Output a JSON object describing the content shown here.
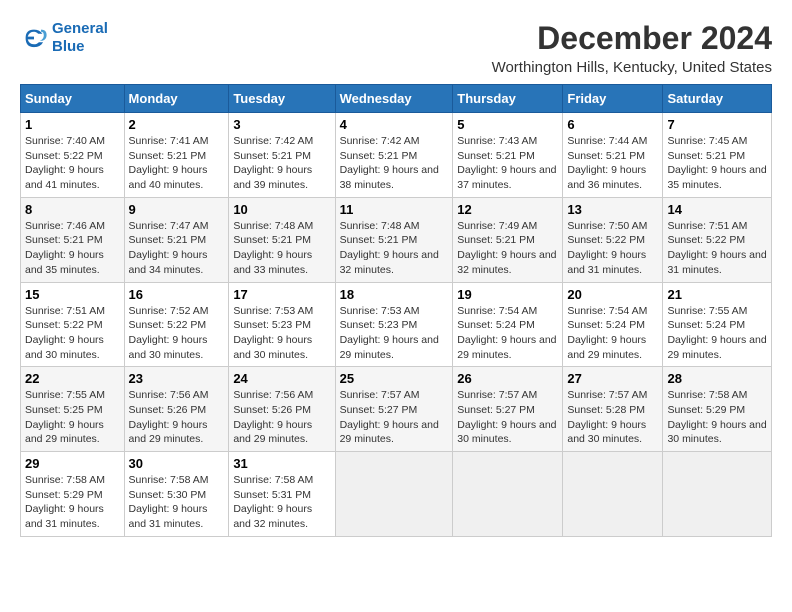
{
  "logo": {
    "line1": "General",
    "line2": "Blue"
  },
  "title": "December 2024",
  "subtitle": "Worthington Hills, Kentucky, United States",
  "headers": [
    "Sunday",
    "Monday",
    "Tuesday",
    "Wednesday",
    "Thursday",
    "Friday",
    "Saturday"
  ],
  "weeks": [
    [
      {
        "day": "1",
        "sunrise": "Sunrise: 7:40 AM",
        "sunset": "Sunset: 5:22 PM",
        "daylight": "Daylight: 9 hours and 41 minutes."
      },
      {
        "day": "2",
        "sunrise": "Sunrise: 7:41 AM",
        "sunset": "Sunset: 5:21 PM",
        "daylight": "Daylight: 9 hours and 40 minutes."
      },
      {
        "day": "3",
        "sunrise": "Sunrise: 7:42 AM",
        "sunset": "Sunset: 5:21 PM",
        "daylight": "Daylight: 9 hours and 39 minutes."
      },
      {
        "day": "4",
        "sunrise": "Sunrise: 7:42 AM",
        "sunset": "Sunset: 5:21 PM",
        "daylight": "Daylight: 9 hours and 38 minutes."
      },
      {
        "day": "5",
        "sunrise": "Sunrise: 7:43 AM",
        "sunset": "Sunset: 5:21 PM",
        "daylight": "Daylight: 9 hours and 37 minutes."
      },
      {
        "day": "6",
        "sunrise": "Sunrise: 7:44 AM",
        "sunset": "Sunset: 5:21 PM",
        "daylight": "Daylight: 9 hours and 36 minutes."
      },
      {
        "day": "7",
        "sunrise": "Sunrise: 7:45 AM",
        "sunset": "Sunset: 5:21 PM",
        "daylight": "Daylight: 9 hours and 35 minutes."
      }
    ],
    [
      {
        "day": "8",
        "sunrise": "Sunrise: 7:46 AM",
        "sunset": "Sunset: 5:21 PM",
        "daylight": "Daylight: 9 hours and 35 minutes."
      },
      {
        "day": "9",
        "sunrise": "Sunrise: 7:47 AM",
        "sunset": "Sunset: 5:21 PM",
        "daylight": "Daylight: 9 hours and 34 minutes."
      },
      {
        "day": "10",
        "sunrise": "Sunrise: 7:48 AM",
        "sunset": "Sunset: 5:21 PM",
        "daylight": "Daylight: 9 hours and 33 minutes."
      },
      {
        "day": "11",
        "sunrise": "Sunrise: 7:48 AM",
        "sunset": "Sunset: 5:21 PM",
        "daylight": "Daylight: 9 hours and 32 minutes."
      },
      {
        "day": "12",
        "sunrise": "Sunrise: 7:49 AM",
        "sunset": "Sunset: 5:21 PM",
        "daylight": "Daylight: 9 hours and 32 minutes."
      },
      {
        "day": "13",
        "sunrise": "Sunrise: 7:50 AM",
        "sunset": "Sunset: 5:22 PM",
        "daylight": "Daylight: 9 hours and 31 minutes."
      },
      {
        "day": "14",
        "sunrise": "Sunrise: 7:51 AM",
        "sunset": "Sunset: 5:22 PM",
        "daylight": "Daylight: 9 hours and 31 minutes."
      }
    ],
    [
      {
        "day": "15",
        "sunrise": "Sunrise: 7:51 AM",
        "sunset": "Sunset: 5:22 PM",
        "daylight": "Daylight: 9 hours and 30 minutes."
      },
      {
        "day": "16",
        "sunrise": "Sunrise: 7:52 AM",
        "sunset": "Sunset: 5:22 PM",
        "daylight": "Daylight: 9 hours and 30 minutes."
      },
      {
        "day": "17",
        "sunrise": "Sunrise: 7:53 AM",
        "sunset": "Sunset: 5:23 PM",
        "daylight": "Daylight: 9 hours and 30 minutes."
      },
      {
        "day": "18",
        "sunrise": "Sunrise: 7:53 AM",
        "sunset": "Sunset: 5:23 PM",
        "daylight": "Daylight: 9 hours and 29 minutes."
      },
      {
        "day": "19",
        "sunrise": "Sunrise: 7:54 AM",
        "sunset": "Sunset: 5:24 PM",
        "daylight": "Daylight: 9 hours and 29 minutes."
      },
      {
        "day": "20",
        "sunrise": "Sunrise: 7:54 AM",
        "sunset": "Sunset: 5:24 PM",
        "daylight": "Daylight: 9 hours and 29 minutes."
      },
      {
        "day": "21",
        "sunrise": "Sunrise: 7:55 AM",
        "sunset": "Sunset: 5:24 PM",
        "daylight": "Daylight: 9 hours and 29 minutes."
      }
    ],
    [
      {
        "day": "22",
        "sunrise": "Sunrise: 7:55 AM",
        "sunset": "Sunset: 5:25 PM",
        "daylight": "Daylight: 9 hours and 29 minutes."
      },
      {
        "day": "23",
        "sunrise": "Sunrise: 7:56 AM",
        "sunset": "Sunset: 5:26 PM",
        "daylight": "Daylight: 9 hours and 29 minutes."
      },
      {
        "day": "24",
        "sunrise": "Sunrise: 7:56 AM",
        "sunset": "Sunset: 5:26 PM",
        "daylight": "Daylight: 9 hours and 29 minutes."
      },
      {
        "day": "25",
        "sunrise": "Sunrise: 7:57 AM",
        "sunset": "Sunset: 5:27 PM",
        "daylight": "Daylight: 9 hours and 29 minutes."
      },
      {
        "day": "26",
        "sunrise": "Sunrise: 7:57 AM",
        "sunset": "Sunset: 5:27 PM",
        "daylight": "Daylight: 9 hours and 30 minutes."
      },
      {
        "day": "27",
        "sunrise": "Sunrise: 7:57 AM",
        "sunset": "Sunset: 5:28 PM",
        "daylight": "Daylight: 9 hours and 30 minutes."
      },
      {
        "day": "28",
        "sunrise": "Sunrise: 7:58 AM",
        "sunset": "Sunset: 5:29 PM",
        "daylight": "Daylight: 9 hours and 30 minutes."
      }
    ],
    [
      {
        "day": "29",
        "sunrise": "Sunrise: 7:58 AM",
        "sunset": "Sunset: 5:29 PM",
        "daylight": "Daylight: 9 hours and 31 minutes."
      },
      {
        "day": "30",
        "sunrise": "Sunrise: 7:58 AM",
        "sunset": "Sunset: 5:30 PM",
        "daylight": "Daylight: 9 hours and 31 minutes."
      },
      {
        "day": "31",
        "sunrise": "Sunrise: 7:58 AM",
        "sunset": "Sunset: 5:31 PM",
        "daylight": "Daylight: 9 hours and 32 minutes."
      },
      null,
      null,
      null,
      null
    ]
  ]
}
